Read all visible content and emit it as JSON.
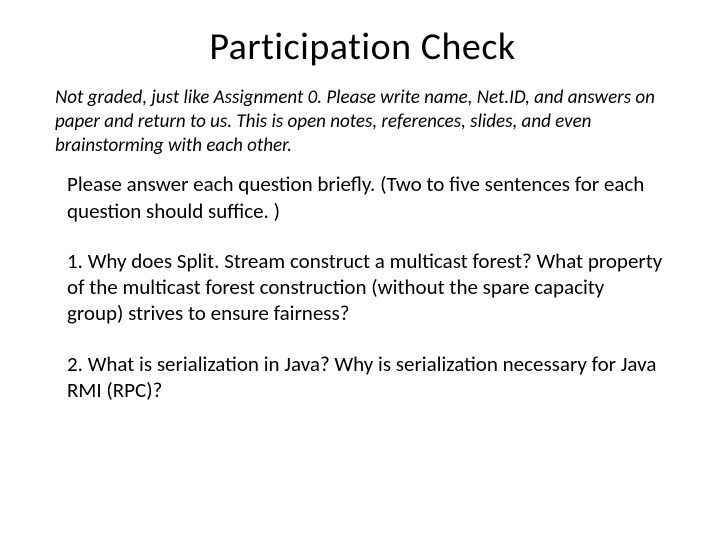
{
  "title": "Participation Check",
  "subtitle": "Not graded, just like Assignment 0. Please write name, Net.ID, and answers on paper and return to us. This is open notes, references, slides, and even brainstorming with each other.",
  "instruction": "Please answer each question briefly. (Two to five sentences for each question should suffice. )",
  "question1": "1. Why does Split. Stream construct a multicast forest? What property of the multicast forest construction (without the spare capacity group) strives to ensure fairness?",
  "question2": "2. What is serialization in Java? Why is serialization necessary for Java RMI (RPC)?"
}
